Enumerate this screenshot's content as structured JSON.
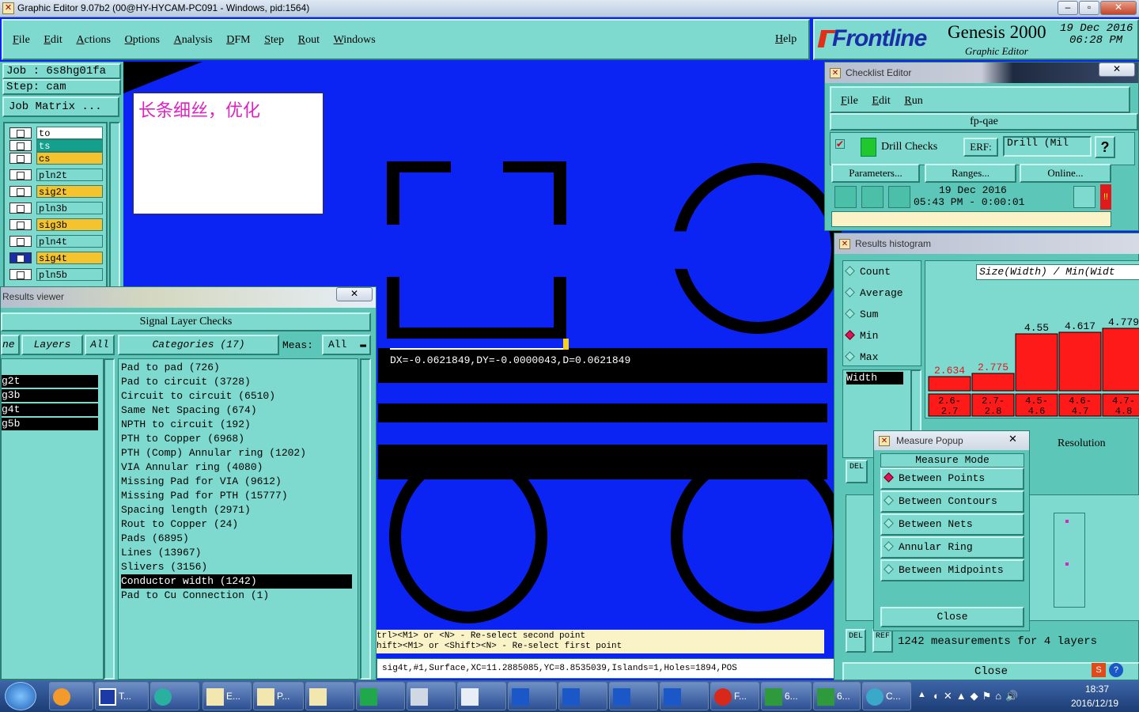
{
  "window": {
    "title": "Graphic Editor 9.07b2 (00@HY-HYCAM-PC091 - Windows, pid:1564)"
  },
  "menu": {
    "items": [
      "File",
      "Edit",
      "Actions",
      "Options",
      "Analysis",
      "DFM",
      "Step",
      "Rout",
      "Windows"
    ],
    "help": "Help"
  },
  "brand": {
    "logo": "Frontline",
    "product": "Genesis 2000",
    "subtitle": "Graphic Editor",
    "date": "19 Dec 2016",
    "time": "06:28 PM"
  },
  "job": {
    "job_line": "Job : 6s8hg01fa",
    "step_line": "Step: cam",
    "matrix_button": "Job Matrix ..."
  },
  "layers": [
    "to",
    "ts",
    "cs",
    "pln2t",
    "sig2t",
    "pln3b",
    "sig3b",
    "pln4t",
    "sig4t",
    "pln5b"
  ],
  "note": {
    "text": "长条细丝，优化"
  },
  "canvas": {
    "measure_readout": "DX=-0.0621849,DY=-0.0000043,D=0.0621849"
  },
  "hints": [
    "trl><M1> or <N> - Re-select second point",
    "hift><M1> or <Shift><N> - Re-select first point"
  ],
  "status": {
    "feature": "sig4t,#1,Surface,XC=11.2885085,YC=8.8535039,Islands=1,Holes=1894,POS"
  },
  "results_viewer": {
    "title": "Results viewer",
    "header": "Signal Layer Checks",
    "tabs": {
      "left": "ne",
      "layers": "Layers",
      "all": "All",
      "categories": "Categories (17)",
      "meas": "Meas:",
      "meas_value": "All"
    },
    "layer_items": [
      "g2t",
      "g3b",
      "g4t",
      "g5b"
    ],
    "categories": [
      "Pad to pad (726)",
      "Pad to circuit (3728)",
      "Circuit to circuit (6510)",
      "Same Net Spacing (674)",
      "NPTH to circuit (192)",
      "PTH to Copper (6968)",
      "PTH (Comp) Annular ring (1202)",
      "VIA Annular ring (4080)",
      "Missing Pad for VIA (9612)",
      "Missing Pad for PTH (15777)",
      "Spacing length (2971)",
      "Rout to Copper (24)",
      "Pads (6895)",
      "Lines (13967)",
      "Slivers (3156)",
      "Conductor width (1242)",
      "Pad to Cu Connection (1)"
    ],
    "selected_category": "Conductor width (1242)"
  },
  "checklist": {
    "title": "Checklist Editor",
    "menu": [
      "File",
      "Edit",
      "Run"
    ],
    "name": "fp-qae",
    "check_name": "Drill Checks",
    "erf_label": "ERF:",
    "erf_value": "Drill (Mil",
    "help": "?",
    "buttons": [
      "Parameters...",
      "Ranges...",
      "Online..."
    ],
    "run_date": "19 Dec 2016",
    "run_time": "05:43 PM - 0:00:01"
  },
  "histogram": {
    "title": "Results histogram",
    "options": [
      "Count",
      "Average",
      "Sum",
      "Min",
      "Max"
    ],
    "selected_option": "Min",
    "field": "Width",
    "chart_title": "Size(Width) / Min(Widt",
    "resolution": "Resolution",
    "del": "DEL",
    "ref": "REF",
    "summary": "1242 measurements for 4 layers",
    "close": "Close",
    "bar_color": "#ff1a1a"
  },
  "chart_data": {
    "type": "bar",
    "title": "Size(Width) / Min(Widt",
    "categories": [
      "2.6-2.7",
      "2.7-2.8",
      "4.5-4.6",
      "4.6-4.7",
      "4.7-4.8"
    ],
    "values": [
      2.634,
      2.775,
      4.55,
      4.617,
      4.779
    ],
    "labels": [
      "2.634",
      "2.775",
      "4.55",
      "4.617",
      "4.779"
    ],
    "range_labels": [
      [
        "2.6-",
        "2.7"
      ],
      [
        "2.7-",
        "2.8"
      ],
      [
        "4.5-",
        "4.6"
      ],
      [
        "4.6-",
        "4.7"
      ],
      [
        "4.7-",
        "4.8"
      ]
    ]
  },
  "measure_popup": {
    "title": "Measure Popup",
    "mode_header": "Measure Mode",
    "modes": [
      "Between Points",
      "Between Contours",
      "Between Nets",
      "Annular Ring",
      "Between Midpoints"
    ],
    "selected": "Between Points",
    "close": "Close"
  },
  "taskbar": {
    "time": "18:37",
    "date": "2016/12/19",
    "buttons": [
      "T...",
      "E...",
      "P...",
      "F...",
      "6...",
      "6...",
      "C..."
    ]
  }
}
